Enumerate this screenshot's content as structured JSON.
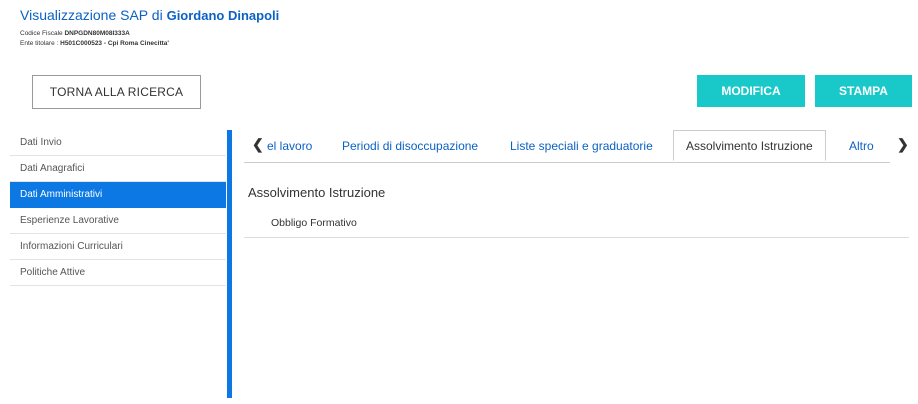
{
  "header": {
    "title_prefix": "Visualizzazione SAP di ",
    "title_name": "Giordano Dinapoli",
    "cf_label": "Codice Fiscale",
    "cf_value": "DNPGDN80M08I333A",
    "ente_label": "Ente titolare :",
    "ente_value": "H501C000523 - Cpi Roma Cinecitta'"
  },
  "buttons": {
    "back": "TORNA ALLA RICERCA",
    "edit": "MODIFICA",
    "print": "STAMPA"
  },
  "sidebar": {
    "items": [
      {
        "label": "Dati Invio"
      },
      {
        "label": "Dati Anagrafici"
      },
      {
        "label": "Dati Amministrativi"
      },
      {
        "label": "Esperienze Lavorative"
      },
      {
        "label": "Informazioni Curriculari"
      },
      {
        "label": "Politiche Attive"
      }
    ],
    "active_index": 2
  },
  "tabs": {
    "items": [
      {
        "label": "el lavoro"
      },
      {
        "label": "Periodi di disoccupazione"
      },
      {
        "label": "Liste speciali e graduatorie"
      },
      {
        "label": "Assolvimento Istruzione"
      },
      {
        "label": "Altro"
      }
    ],
    "active_index": 3
  },
  "content": {
    "section_title": "Assolvimento Istruzione",
    "rows": [
      {
        "label": "Obbligo Formativo"
      }
    ]
  },
  "colors": {
    "accent": "#0b78e3",
    "button": "#19c9c9",
    "link": "#0b61c6"
  },
  "icons": {
    "tab_prev": "chevron-left-icon",
    "tab_next": "chevron-right-icon"
  }
}
